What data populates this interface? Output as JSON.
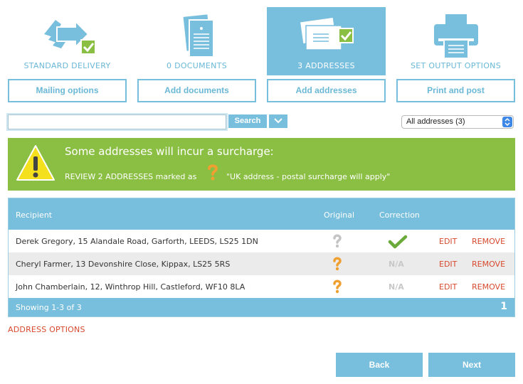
{
  "steps": [
    {
      "label": "STANDARD DELIVERY",
      "icon": "delivery-arrows-checked-icon",
      "button": "Mailing options",
      "active": false
    },
    {
      "label": "0 DOCUMENTS",
      "icon": "documents-icon",
      "button": "Add documents",
      "active": false
    },
    {
      "label": "3 ADDRESSES",
      "icon": "envelopes-checked-icon",
      "button": "Add addresses",
      "active": true
    },
    {
      "label": "SET OUTPUT OPTIONS",
      "icon": "printer-icon",
      "button": "Print and post",
      "active": false
    }
  ],
  "search": {
    "value": "",
    "placeholder": "",
    "button_label": "Search"
  },
  "filter": {
    "selected": "All addresses (3)"
  },
  "alert": {
    "title": "Some addresses will incur a surcharge:",
    "text_before": "REVIEW 2 ADDRESSES marked as",
    "text_after": "\"UK address - postal surcharge will apply\""
  },
  "table": {
    "headers": {
      "recipient": "Recipient",
      "original": "Original",
      "correction": "Correction"
    },
    "rows": [
      {
        "recipient": "Derek Gregory, 15 Alandale Road, Garforth, LEEDS, LS25 1DN",
        "original_icon": "question-mark-grey-icon",
        "correction": "check-icon",
        "edit": "EDIT",
        "remove": "REMOVE"
      },
      {
        "recipient": "Cheryl Farmer, 13 Devonshire Close, Kippax, LS25 5RS",
        "original_icon": "question-mark-orange-icon",
        "correction": "N/A",
        "edit": "EDIT",
        "remove": "REMOVE"
      },
      {
        "recipient": "John Chamberlain, 12, Winthrop Hill, Castleford, WF10 8LA",
        "original_icon": "question-mark-orange-icon",
        "correction": "N/A",
        "edit": "EDIT",
        "remove": "REMOVE"
      }
    ],
    "footer": {
      "showing": "Showing 1-3 of 3",
      "page": "1"
    }
  },
  "address_options": "ADDRESS OPTIONS",
  "nav": {
    "back": "Back",
    "next": "Next"
  },
  "colors": {
    "accent": "#78bedd",
    "alert_green": "#8bbf44",
    "link_red": "#d8492e",
    "warning_orange": "#f0a030",
    "check_green": "#6aaa3a"
  }
}
